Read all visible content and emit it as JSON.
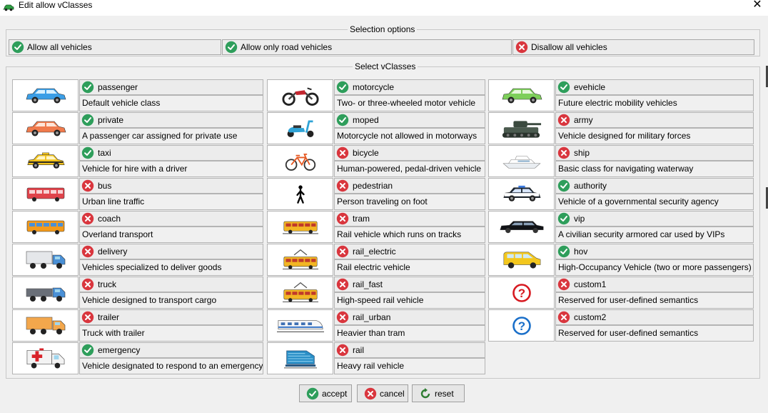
{
  "window": {
    "title": "Edit allow vClasses",
    "close_glyph": "✕"
  },
  "selection_options": {
    "legend": "Selection options",
    "buttons": [
      {
        "label": "Allow all vehicles",
        "icon": "check-icon"
      },
      {
        "label": "Allow only road vehicles",
        "icon": "check-icon"
      },
      {
        "label": "Disallow all vehicles",
        "icon": "cross-icon"
      }
    ]
  },
  "vclasses": {
    "legend": "Select vClasses",
    "columns": [
      [
        {
          "name": "passenger",
          "allowed": true,
          "description": "Default vehicle class",
          "image": "passenger-car-icon"
        },
        {
          "name": "private",
          "allowed": true,
          "description": "A passenger car assigned for private use",
          "image": "private-car-icon"
        },
        {
          "name": "taxi",
          "allowed": true,
          "description": "Vehicle for hire with a driver",
          "image": "taxi-icon"
        },
        {
          "name": "bus",
          "allowed": false,
          "description": "Urban line traffic",
          "image": "bus-icon"
        },
        {
          "name": "coach",
          "allowed": false,
          "description": "Overland transport",
          "image": "coach-icon"
        },
        {
          "name": "delivery",
          "allowed": false,
          "description": "Vehicles specialized to deliver goods",
          "image": "delivery-truck-icon"
        },
        {
          "name": "truck",
          "allowed": false,
          "description": "Vehicle designed to transport cargo",
          "image": "truck-icon"
        },
        {
          "name": "trailer",
          "allowed": false,
          "description": "Truck with trailer",
          "image": "trailer-truck-icon"
        },
        {
          "name": "emergency",
          "allowed": true,
          "description": "Vehicle designated to respond to an emergency",
          "image": "ambulance-icon"
        }
      ],
      [
        {
          "name": "motorcycle",
          "allowed": true,
          "description": "Two- or three-wheeled motor vehicle",
          "image": "motorcycle-icon"
        },
        {
          "name": "moped",
          "allowed": true,
          "description": "Motorcycle not allowed in motorways",
          "image": "moped-icon"
        },
        {
          "name": "bicycle",
          "allowed": false,
          "description": "Human-powered, pedal-driven vehicle",
          "image": "bicycle-icon"
        },
        {
          "name": "pedestrian",
          "allowed": false,
          "description": "Person traveling on foot",
          "image": "pedestrian-icon"
        },
        {
          "name": "tram",
          "allowed": false,
          "description": "Rail vehicle which runs on tracks",
          "image": "tram-icon"
        },
        {
          "name": "rail_electric",
          "allowed": false,
          "description": "Rail electric vehicle",
          "image": "electric-tram-icon"
        },
        {
          "name": "rail_fast",
          "allowed": false,
          "description": "High-speed rail vehicle",
          "image": "fast-rail-icon"
        },
        {
          "name": "rail_urban",
          "allowed": false,
          "description": "Heavier than tram",
          "image": "urban-train-icon"
        },
        {
          "name": "rail",
          "allowed": false,
          "description": "Heavy rail vehicle",
          "image": "locomotive-icon"
        }
      ],
      [
        {
          "name": "evehicle",
          "allowed": true,
          "description": "Future electric mobility vehicles",
          "image": "electric-car-icon"
        },
        {
          "name": "army",
          "allowed": false,
          "description": "Vehicle designed for military forces",
          "image": "tank-icon"
        },
        {
          "name": "ship",
          "allowed": false,
          "description": "Basic class for navigating waterway",
          "image": "ship-icon"
        },
        {
          "name": "authority",
          "allowed": true,
          "description": "Vehicle of a governmental security agency",
          "image": "police-car-icon"
        },
        {
          "name": "vip",
          "allowed": true,
          "description": "A civilian security armored car used by VIPs",
          "image": "limousine-icon"
        },
        {
          "name": "hov",
          "allowed": true,
          "description": "High-Occupancy Vehicle (two or more passengers)",
          "image": "van-icon"
        },
        {
          "name": "custom1",
          "allowed": false,
          "description": "Reserved for user-defined semantics",
          "image": "question-red-icon"
        },
        {
          "name": "custom2",
          "allowed": false,
          "description": "Reserved for user-defined semantics",
          "image": "question-blue-icon"
        }
      ]
    ]
  },
  "actions": [
    {
      "label": "accept",
      "icon": "check-icon"
    },
    {
      "label": "cancel",
      "icon": "cross-icon"
    },
    {
      "label": "reset",
      "icon": "reset-icon"
    }
  ],
  "colors": {
    "check": "#2e9e5b",
    "cross": "#d9363e",
    "question_red": "#d71920",
    "question_blue": "#1a6fc9"
  }
}
